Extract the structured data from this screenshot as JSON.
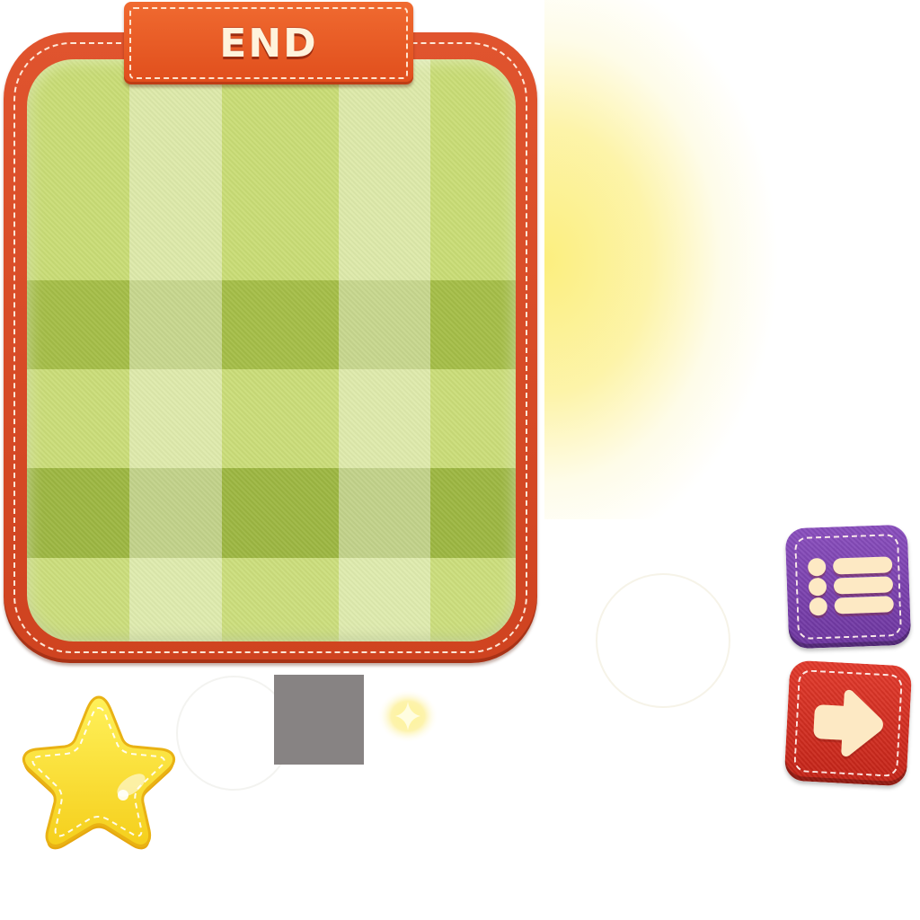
{
  "end_panel": {
    "title": "END"
  },
  "buttons": {
    "menu_icon": "list-icon",
    "next_icon": "arrow-right-icon"
  },
  "decorations": {
    "star_icon": "star-icon",
    "sparkle_icon": "sparkle-icon",
    "swatch_color": "#878383"
  },
  "colors": {
    "frame": "#d94a26",
    "board": "#bfd65c",
    "menu_button": "#7a40ad",
    "next_button": "#d42f22",
    "glow": "#fcee78",
    "star": "#fbe032"
  }
}
